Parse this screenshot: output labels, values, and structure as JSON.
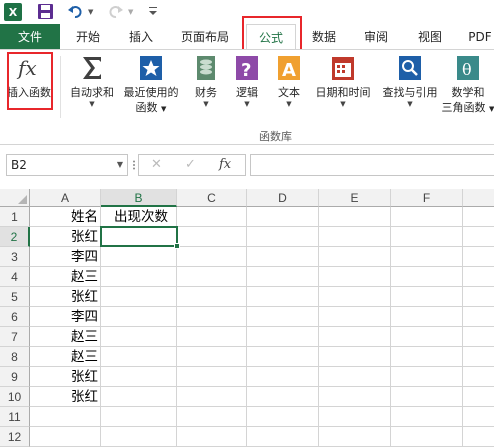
{
  "app": {
    "logo_letter": "X"
  },
  "tabs": [
    {
      "id": "file",
      "label": "文件"
    },
    {
      "id": "home",
      "label": "开始"
    },
    {
      "id": "insert",
      "label": "插入"
    },
    {
      "id": "layout",
      "label": "页面布局"
    },
    {
      "id": "formulas",
      "label": "公式"
    },
    {
      "id": "data",
      "label": "数据"
    },
    {
      "id": "review",
      "label": "审阅"
    },
    {
      "id": "view",
      "label": "视图"
    },
    {
      "id": "pdf",
      "label": "PDF"
    }
  ],
  "ribbon": {
    "group_label": "函数库",
    "buttons": [
      {
        "label": "插入函数",
        "icon": "fx-icon"
      },
      {
        "label": "自动求和",
        "icon": "sigma-icon"
      },
      {
        "label": "最近使用的",
        "label2": "函数",
        "icon": "star-icon"
      },
      {
        "label": "财务",
        "icon": "coins-icon"
      },
      {
        "label": "逻辑",
        "icon": "question-icon"
      },
      {
        "label": "文本",
        "icon": "text-a-icon"
      },
      {
        "label": "日期和时间",
        "icon": "calendar-icon"
      },
      {
        "label": "查找与引用",
        "icon": "magnifier-icon"
      },
      {
        "label": "数学和",
        "label2": "三角函数",
        "icon": "theta-icon"
      }
    ]
  },
  "formula_bar": {
    "name_box": "B2",
    "cancel_glyph": "✕",
    "enter_glyph": "✓",
    "fx_glyph": "fx",
    "formula": ""
  },
  "sheet": {
    "columns": [
      "A",
      "B",
      "C",
      "D",
      "E",
      "F"
    ],
    "selected_column": "B",
    "rows": [
      "1",
      "2",
      "3",
      "4",
      "5",
      "6",
      "7",
      "8",
      "9",
      "10",
      "11",
      "12",
      "13"
    ],
    "selected_row": "2",
    "colA": [
      "姓名",
      "张红",
      "李四",
      "赵三",
      "张红",
      "李四",
      "赵三",
      "赵三",
      "张红",
      "张红",
      "",
      "",
      ""
    ],
    "colB": [
      "出现次数",
      "",
      "",
      "",
      "",
      "",
      "",
      "",
      "",
      "",
      "",
      "",
      ""
    ],
    "active_cell": "B2"
  },
  "colors": {
    "accent": "#217346",
    "highlight": "#e8262b"
  }
}
